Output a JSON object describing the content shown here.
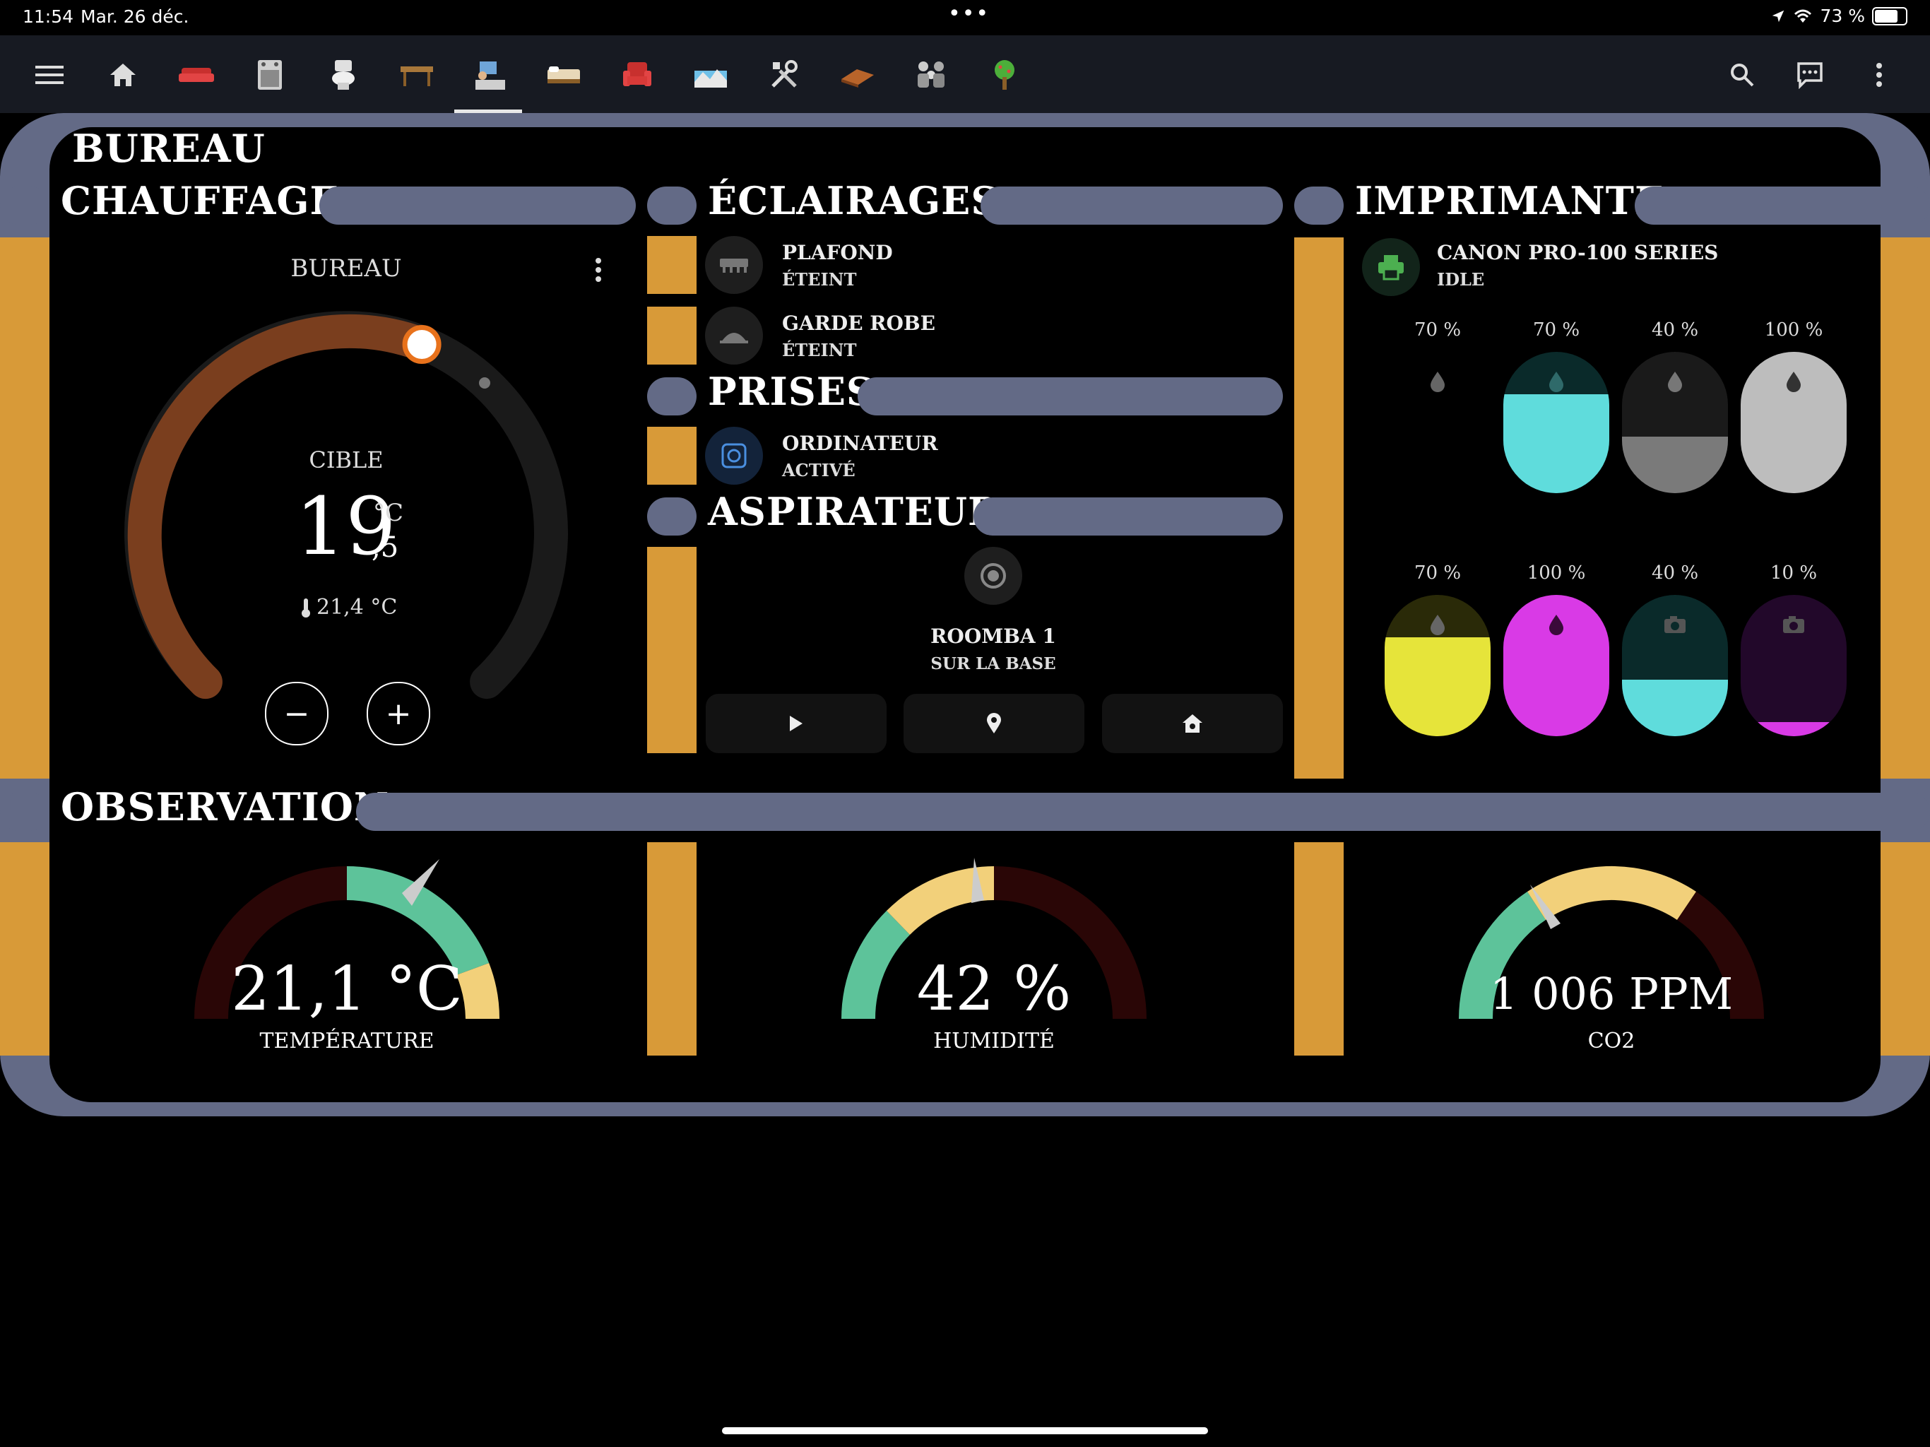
{
  "status": {
    "time": "11:54",
    "date": "Mar. 26 déc.",
    "battery": "73 %"
  },
  "toolbar": {
    "tabs": [
      "home",
      "sofa",
      "kitchen",
      "bathroom",
      "dining",
      "office",
      "bedroom",
      "armchair",
      "outside",
      "tools",
      "shelf",
      "family",
      "garden"
    ],
    "active_tab": "office"
  },
  "page": {
    "title": "BUREAU"
  },
  "heating": {
    "section": "CHAUFFAGE",
    "name": "BUREAU",
    "target_label": "CIBLE",
    "target_int": "19",
    "target_dec": ",5",
    "unit": "°C",
    "current": "21,4 °C",
    "minus": "−",
    "plus": "+"
  },
  "lights": {
    "section": "ÉCLAIRAGES",
    "items": [
      {
        "name": "PLAFOND",
        "state": "ÉTEINT"
      },
      {
        "name": "GARDE ROBE",
        "state": "ÉTEINT"
      }
    ]
  },
  "plugs": {
    "section": "PRISES",
    "items": [
      {
        "name": "ORDINATEUR",
        "state": "ACTIVÉ"
      }
    ]
  },
  "vacuum": {
    "section": "ASPIRATEUR",
    "name": "ROOMBA 1",
    "state": "SUR LA BASE"
  },
  "printer": {
    "section": "IMPRIMANTE",
    "name": "CANON PRO-100 SERIES",
    "state": "IDLE",
    "inks_top": [
      {
        "pct": "70 %",
        "level": 0.7,
        "color": "#000000"
      },
      {
        "pct": "70 %",
        "level": 0.7,
        "color": "#5fdcdc"
      },
      {
        "pct": "40 %",
        "level": 0.4,
        "color": "#7a7a7a"
      },
      {
        "pct": "100 %",
        "level": 1.0,
        "color": "#bdbdbd"
      }
    ],
    "inks_bottom": [
      {
        "pct": "70 %",
        "level": 0.7,
        "color": "#e6e43a"
      },
      {
        "pct": "100 %",
        "level": 1.0,
        "color": "#d93ae6"
      },
      {
        "pct": "40 %",
        "level": 0.4,
        "color": "#5fdcdc"
      },
      {
        "pct": "10 %",
        "level": 0.1,
        "color": "#d93ae6"
      }
    ]
  },
  "observation": {
    "section": "OBSERVATION",
    "temperature": {
      "value": "21,1 °C",
      "label": "TEMPÉRATURE"
    },
    "humidity": {
      "value": "42 %",
      "label": "HUMIDITÉ"
    },
    "co2": {
      "value": "1 006 PPM",
      "label": "CO2"
    }
  }
}
